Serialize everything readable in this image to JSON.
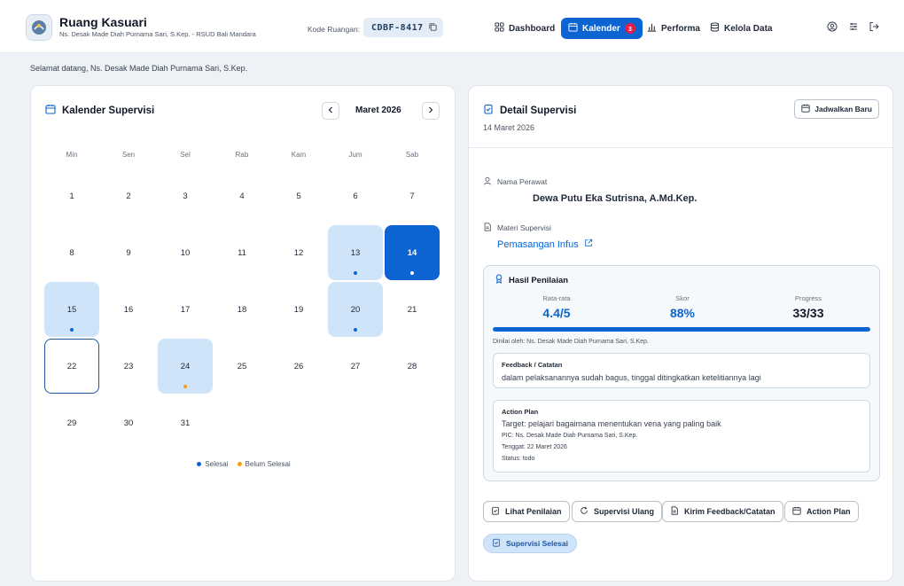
{
  "header": {
    "app_title": "Ruang Kasuari",
    "app_subtitle": "Ns. Desak Made Diah Purnama Sari, S.Kep. - RSUD Bali Mandara",
    "room_label": "Kode Ruangan:",
    "room_code": "CDBF-8417",
    "nav": [
      {
        "label": "Dashboard",
        "icon": "grid-icon"
      },
      {
        "label": "Kalender",
        "icon": "calendar-icon",
        "badge": "3"
      },
      {
        "label": "Performa",
        "icon": "bar-chart-icon"
      },
      {
        "label": "Kelola Data",
        "icon": "database-icon"
      }
    ]
  },
  "welcome": "Selamat datang, Ns. Desak Made Diah Purnama Sari, S.Kep.",
  "calendar": {
    "title": "Kalender Supervisi",
    "month_label": "Maret 2026",
    "weekdays": [
      "Min",
      "Sen",
      "Sel",
      "Rab",
      "Kam",
      "Jum",
      "Sab"
    ],
    "days": [
      "1",
      "2",
      "3",
      "4",
      "5",
      "6",
      "7",
      "8",
      "9",
      "10",
      "11",
      "12",
      "13",
      "14",
      "15",
      "16",
      "17",
      "18",
      "19",
      "20",
      "21",
      "22",
      "23",
      "24",
      "25",
      "26",
      "27",
      "28",
      "29",
      "30",
      "31"
    ],
    "legend": {
      "done": "Selesai",
      "pending": "Belum Selesai"
    }
  },
  "detail": {
    "title": "Detail Supervisi",
    "date": "14 Maret 2026",
    "schedule_button": "Jadwalkan Baru",
    "nurse_label": "Nama Perawat",
    "nurse_name": "Dewa Putu Eka Sutrisna, A.Md.Kep.",
    "materi_label": "Materi Supervisi",
    "materi_value": "Pemasangan Infus",
    "result": {
      "title": "Hasil Penilaian",
      "avg_label": "Rata-rata",
      "avg_value": "4.4/5",
      "score_label": "Skor",
      "score_value": "88%",
      "progress_label": "Progress",
      "progress_value": "33/33",
      "progress_fraction": 1.0,
      "rated_by": "Dinilai oleh: Ns. Desak Made Diah Purnama Sari, S.Kep.",
      "feedback_title": "Feedback / Catatan",
      "feedback_text": "dalam pelaksanannya sudah bagus, tinggal ditingkatkan ketelitiannya lagi",
      "action_plan_title": "Action Plan",
      "action_target": "Target: pelajari bagaimana menentukan vena yang paling baik",
      "action_pic": "PIC: Ns. Desak Made Diah Purnama Sari, S.Kep.",
      "action_deadline": "Tenggat: 22 Maret 2026",
      "action_status": "Status: todo"
    },
    "buttons": {
      "view": "Lihat Penilaian",
      "repeat": "Supervisi Ulang",
      "send_feedback": "Kirim Feedback/Catatan",
      "action_plan": "Action Plan"
    },
    "status_pill": "Supervisi Selesai"
  },
  "colors": {
    "accent": "#0b64d1",
    "done_bg": "#cfe4f8",
    "pending_dot": "#f59e0b",
    "badge": "#e11d48"
  }
}
